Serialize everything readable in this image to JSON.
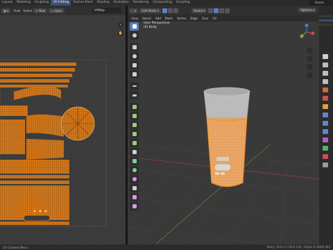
{
  "app": {
    "workspaces": [
      "Layout",
      "Modeling",
      "Sculpting",
      "UV Editing",
      "Texture Paint",
      "Shading",
      "Animation",
      "Rendering",
      "Compositing",
      "Scripting"
    ],
    "active_workspace": "UV Editing",
    "scene_label": "Scene"
  },
  "uv_editor": {
    "view_label": "View",
    "select_label": "Select",
    "new_label": "New",
    "open_label": "Open",
    "uvmap_label": "UVMap"
  },
  "viewport": {
    "mode_label": "Edit Mode",
    "menus": [
      "View",
      "Select",
      "Add",
      "Mesh",
      "Vertex",
      "Edge",
      "Face",
      "UV"
    ],
    "transform_label": "Global",
    "options_label": "Options",
    "info_line1": "User Perspective",
    "info_line2": "(0) Body"
  },
  "status": {
    "left": "UV Context Menu",
    "right": "Body | Verts 4,236/4,236 | Edges 8,384/8,384"
  },
  "colors": {
    "uv_orange": "#e8871e",
    "grid_bg": "#3b3b3b",
    "accent": "#5680c2",
    "bottle_cap": "#b9b9b9",
    "bottle_body": "#e9a86b"
  }
}
